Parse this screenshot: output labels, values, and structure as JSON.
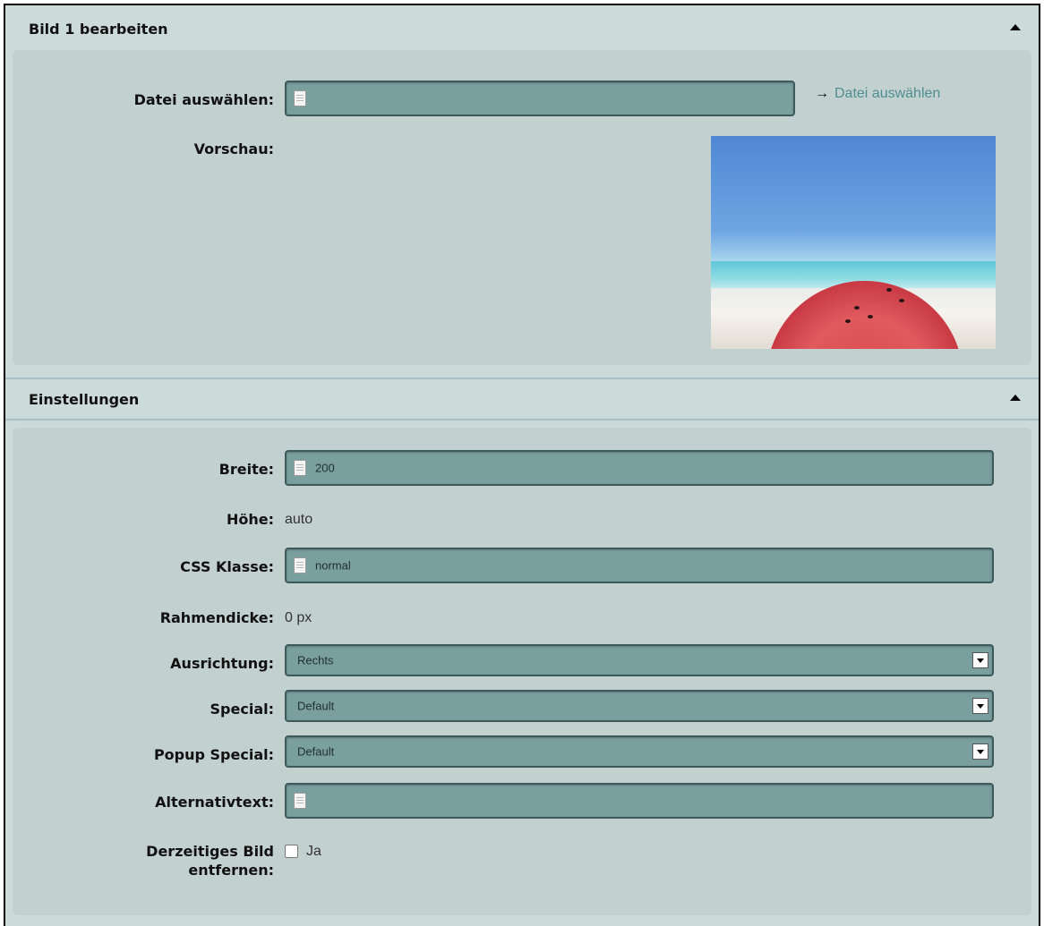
{
  "section1": {
    "title": "Bild 1 bearbeiten",
    "file_label": "Datei auswählen:",
    "file_value": "",
    "file_link": "Datei auswählen",
    "preview_label": "Vorschau:"
  },
  "section2": {
    "title": "Einstellungen",
    "width_label": "Breite:",
    "width_value": "200",
    "height_label": "Höhe:",
    "height_value": "auto",
    "css_label": "CSS Klasse:",
    "css_value": "normal",
    "border_label": "Rahmendicke:",
    "border_value": "0 px",
    "align_label": "Ausrichtung:",
    "align_value": "Rechts",
    "special_label": "Special:",
    "special_value": "Default",
    "popup_label": "Popup Special:",
    "popup_value": "Default",
    "alt_label": "Alternativtext:",
    "alt_value": "",
    "remove_label_line1": "Derzeitiges Bild",
    "remove_label_line2": "entfernen:",
    "remove_option": "Ja"
  },
  "icons": {
    "collapse": "triangle-up-icon",
    "file": "document-icon",
    "dropdown": "chevron-down-icon",
    "link": "arrow-right-icon"
  },
  "colors": {
    "background": "#ccdada",
    "panel": "#c3d0d0",
    "input_fill": "#7a9f9f",
    "input_border": "#3c5a5a",
    "link": "#4f8e8e"
  }
}
